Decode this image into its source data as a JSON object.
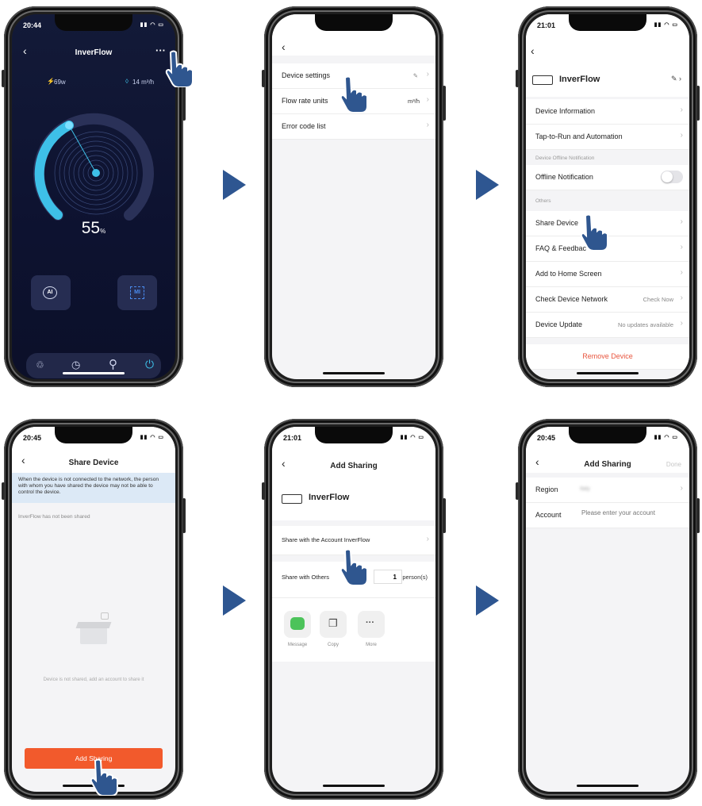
{
  "arrows": [
    "next-step-arrow",
    "next-step-arrow",
    "next-step-arrow",
    "next-step-arrow"
  ],
  "screen1": {
    "time": "20:44",
    "title": "InverFlow",
    "more": "···",
    "power": "69w",
    "flow": "14 m³/h",
    "percent": "55",
    "percent_unit": "%",
    "btn_ai": "AI",
    "btn_mi": "MI",
    "accent": "#3ec0e8"
  },
  "screen2": {
    "items": [
      {
        "label": "Device settings",
        "value": ""
      },
      {
        "label": "Flow rate units",
        "value": "m³/h"
      },
      {
        "label": "Error code list",
        "value": ""
      }
    ]
  },
  "screen3": {
    "time": "21:01",
    "device_name": "InverFlow",
    "device_information": "Device Information",
    "tap_to_run": "Tap-to-Run and Automation",
    "section_offline": "Device Offline Notification",
    "offline_notification": "Offline Notification",
    "section_others": "Others",
    "share_device": "Share Device",
    "faq": "FAQ & Feedbac",
    "add_home": "Add to Home Screen",
    "check_network": "Check Device Network",
    "check_now": "Check Now",
    "device_update": "Device Update",
    "no_updates": "No updates available",
    "remove_device": "Remove Device",
    "remove_color": "#e8553e"
  },
  "screen4": {
    "time": "20:45",
    "title": "Share Device",
    "notice": "When the device is not connected to the network, the person with whom you have shared the device may not be able to control the device.",
    "not_shared": "InverFlow has not been shared",
    "empty_text": "Device is not shared, add an account to share it",
    "add_sharing": "Add Sharing",
    "button_color": "#f25a2c"
  },
  "screen5": {
    "time": "21:01",
    "title": "Add Sharing",
    "device_name": "InverFlow",
    "share_account": "Share with the Account InverFlow",
    "share_others": "Share with Others",
    "count": "1",
    "count_unit": "person(s)",
    "message": "Message",
    "copy": "Copy",
    "more": "More"
  },
  "screen6": {
    "time": "20:45",
    "title": "Add Sharing",
    "done": "Done",
    "region_label": "Region",
    "region_value": "Italy",
    "account_label": "Account",
    "account_placeholder": "Please enter your account"
  }
}
